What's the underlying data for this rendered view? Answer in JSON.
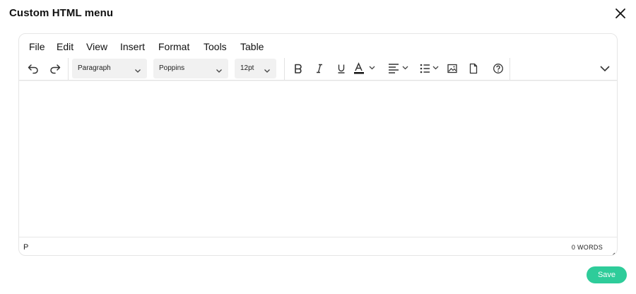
{
  "modal": {
    "title": "Custom HTML menu"
  },
  "menubar": {
    "items": [
      "File",
      "Edit",
      "View",
      "Insert",
      "Format",
      "Tools",
      "Table"
    ]
  },
  "toolbar": {
    "block_format": "Paragraph",
    "font_family": "Poppins",
    "font_size": "12pt",
    "icons": [
      "undo-icon",
      "redo-icon",
      "bold-icon",
      "italic-icon",
      "underline-icon",
      "text-color-icon",
      "align-icon",
      "bullet-list-icon",
      "image-icon",
      "document-icon",
      "help-icon",
      "more-icon"
    ]
  },
  "statusbar": {
    "path": "P",
    "word_count": "0 WORDS"
  },
  "actions": {
    "save_label": "Save"
  },
  "colors": {
    "accent": "#2ecc9a",
    "border": "#e6e6e6",
    "select_bg": "#f1f1f1"
  }
}
